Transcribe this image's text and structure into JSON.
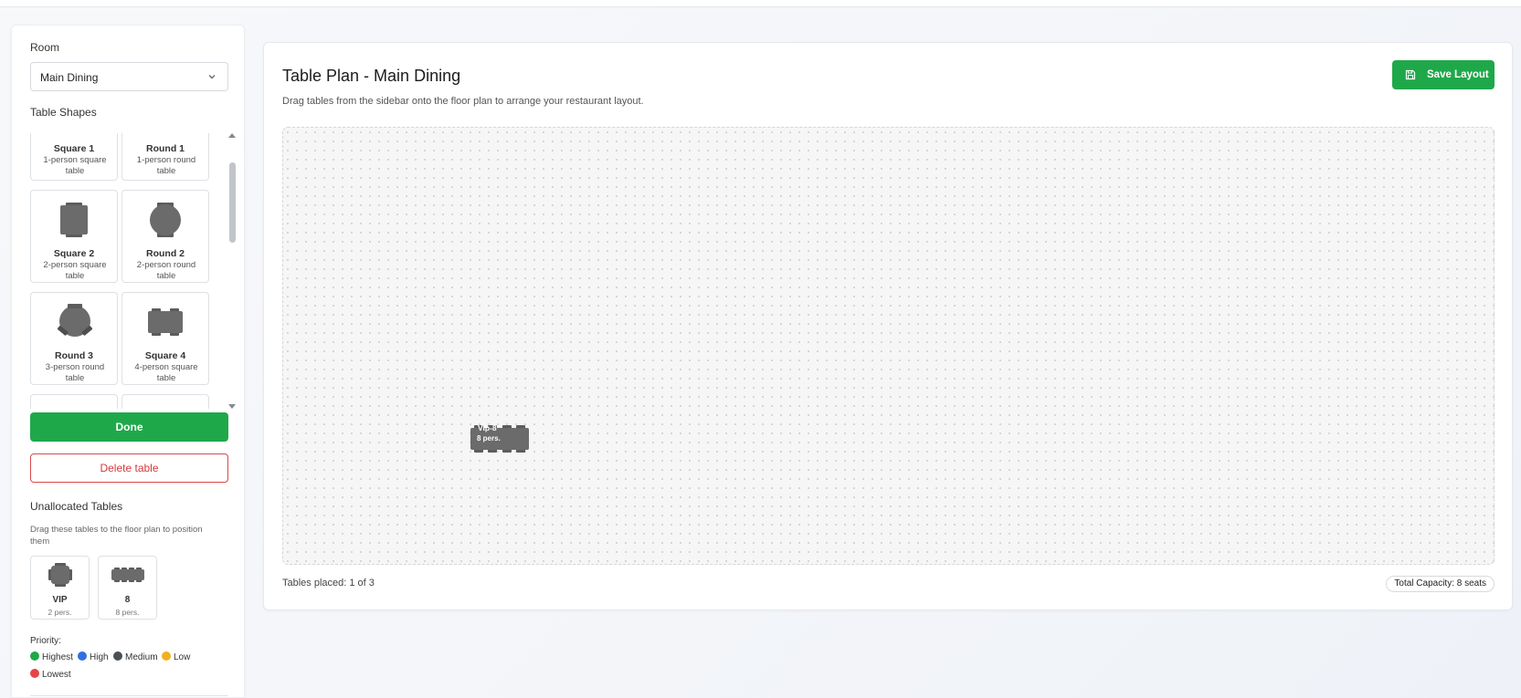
{
  "sidebar": {
    "room_label": "Room",
    "room_value": "Main Dining",
    "shapes_label": "Table Shapes",
    "shapes": [
      {
        "name": "Square 1",
        "desc": "1-person square table"
      },
      {
        "name": "Round 1",
        "desc": "1-person round table"
      },
      {
        "name": "Square 2",
        "desc": "2-person square table"
      },
      {
        "name": "Round 2",
        "desc": "2-person round table"
      },
      {
        "name": "Round 3",
        "desc": "3-person round table"
      },
      {
        "name": "Square 4",
        "desc": "4-person square table"
      }
    ],
    "done_label": "Done",
    "delete_label": "Delete table",
    "unallocated_title": "Unallocated Tables",
    "unallocated_hint": "Drag these tables to the floor plan to position them",
    "unallocated": [
      {
        "name": "VIP",
        "pers": "2 pers."
      },
      {
        "name": "8",
        "pers": "8 pers."
      }
    ],
    "priority_label": "Priority:",
    "priorities": [
      {
        "label": "Highest",
        "color": "#1fa84a"
      },
      {
        "label": "High",
        "color": "#2f6fe0"
      },
      {
        "label": "Medium",
        "color": "#4a4f57"
      },
      {
        "label": "Low",
        "color": "#f2b01e"
      },
      {
        "label": "Lowest",
        "color": "#e54545"
      }
    ]
  },
  "main": {
    "title": "Table Plan - Main Dining",
    "subtitle": "Drag tables from the sidebar onto the floor plan to arrange your restaurant layout.",
    "save_label": "Save Layout",
    "placed_table": {
      "name": "Vip-8",
      "pers": "8 pers."
    },
    "tables_placed": "Tables placed: 1 of 3",
    "capacity": "Total Capacity: 8 seats"
  },
  "colors": {
    "accent": "#1fa84a",
    "danger": "#d63a3a",
    "table": "#6b6b6b"
  }
}
